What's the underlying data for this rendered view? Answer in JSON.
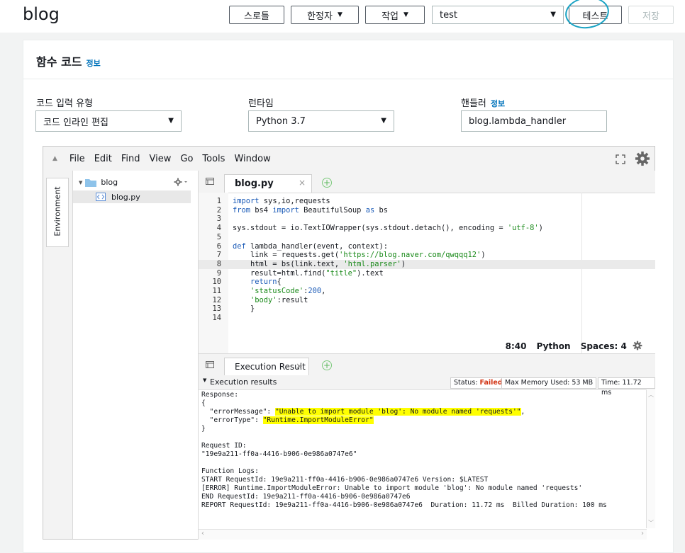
{
  "header": {
    "title": "blog",
    "throttle": "스로틀",
    "qualifier": "한정자",
    "actions": "작업",
    "test_event": "test",
    "test_button": "테스트",
    "save_button": "저장"
  },
  "function_code": {
    "title": "함수 코드",
    "info": "정보",
    "code_entry_label": "코드 입력 유형",
    "code_entry_value": "코드 인라인 편집",
    "runtime_label": "런타임",
    "runtime_value": "Python 3.7",
    "handler_label": "핸들러",
    "handler_info": "정보",
    "handler_value": "blog.lambda_handler"
  },
  "ide": {
    "menu": [
      "File",
      "Edit",
      "Find",
      "View",
      "Go",
      "Tools",
      "Window"
    ],
    "env_tab": "Environment",
    "tree": {
      "folder": "blog",
      "file": "blog.py"
    },
    "editor_tab": "blog.py",
    "code_lines": [
      {
        "n": "1",
        "t": "import sys,io,requests"
      },
      {
        "n": "2",
        "t": "from bs4 import BeautifulSoup as bs"
      },
      {
        "n": "3",
        "t": ""
      },
      {
        "n": "4",
        "t": "sys.stdout = io.TextIOWrapper(sys.stdout.detach(), encoding = 'utf-8')"
      },
      {
        "n": "5",
        "t": ""
      },
      {
        "n": "6",
        "t": "def lambda_handler(event, context):"
      },
      {
        "n": "7",
        "t": "    link = requests.get('https://blog.naver.com/qwqqq12')"
      },
      {
        "n": "8",
        "t": "    html = bs(link.text, 'html.parser')"
      },
      {
        "n": "9",
        "t": "    result=html.find(\"title\").text"
      },
      {
        "n": "10",
        "t": "    return{"
      },
      {
        "n": "11",
        "t": "    'statusCode':200,"
      },
      {
        "n": "12",
        "t": "    'body':result"
      },
      {
        "n": "13",
        "t": "    }"
      },
      {
        "n": "14",
        "t": ""
      }
    ],
    "cursor_pos": "8:40",
    "language": "Python",
    "spaces": "Spaces: 4",
    "result_tab": "Execution Result",
    "exec_title": "Execution results",
    "status_label": "Status:",
    "status_value": "Failed",
    "max_memory": "Max Memory Used: 53 MB",
    "time": "Time: 11.72 ms",
    "output": {
      "l1": "Response:",
      "l2": "{",
      "l3a": "  \"errorMessage\": ",
      "l3b": "\"Unable to import module 'blog': No module named 'requests'\"",
      "l3c": ",",
      "l4a": "  \"errorType\": ",
      "l4b": "\"Runtime.ImportModuleError\"",
      "l5": "}",
      "l6": "Request ID:",
      "l7": "\"19e9a211-ff0a-4416-b906-0e986a0747e6\"",
      "l8": "Function Logs:",
      "l9": "START RequestId: 19e9a211-ff0a-4416-b906-0e986a0747e6 Version: $LATEST",
      "l10": "[ERROR] Runtime.ImportModuleError: Unable to import module 'blog': No module named 'requests'",
      "l11": "END RequestId: 19e9a211-ff0a-4416-b906-0e986a0747e6",
      "l12": "REPORT RequestId: 19e9a211-ff0a-4416-b906-0e986a0747e6  Duration: 11.72 ms  Billed Duration: 100 ms"
    }
  },
  "colors": {
    "failed": "#d13212",
    "link": "#0073bb",
    "highlight": "#ffff00",
    "annotation": "#1aa3c4"
  }
}
